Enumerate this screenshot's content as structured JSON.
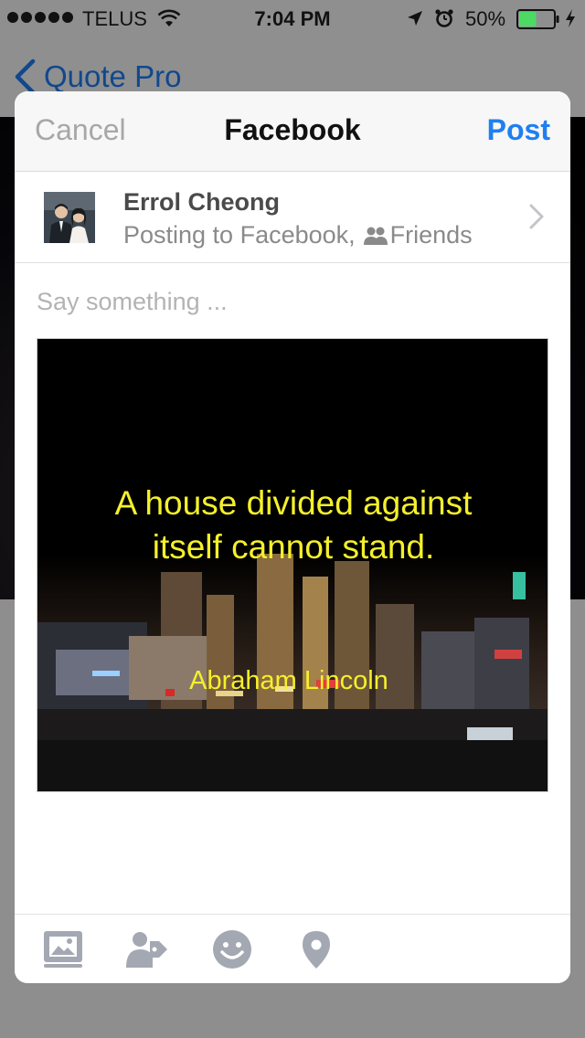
{
  "status_bar": {
    "carrier": "TELUS",
    "time": "7:04 PM",
    "battery_percent": "50%",
    "battery_level": 0.5
  },
  "background_app": {
    "back_label": "Quote Pro"
  },
  "share_sheet": {
    "cancel_label": "Cancel",
    "title": "Facebook",
    "post_label": "Post",
    "account": {
      "name": "Errol Cheong",
      "posting_to": "Posting to Facebook,",
      "audience": "Friends"
    },
    "message": {
      "placeholder": "Say something ...",
      "value": ""
    },
    "attachment": {
      "quote": "A house divided against itself cannot stand.",
      "author": "Abraham Lincoln"
    },
    "toolbar": {
      "icons": [
        "photo-icon",
        "tag-people-icon",
        "emoji-icon",
        "location-pin-icon"
      ]
    }
  },
  "colors": {
    "accent_blue": "#1f7ff0",
    "quote_yellow": "#f4f02b",
    "muted_text": "#8a8a8a",
    "battery_green": "#4cd964"
  }
}
